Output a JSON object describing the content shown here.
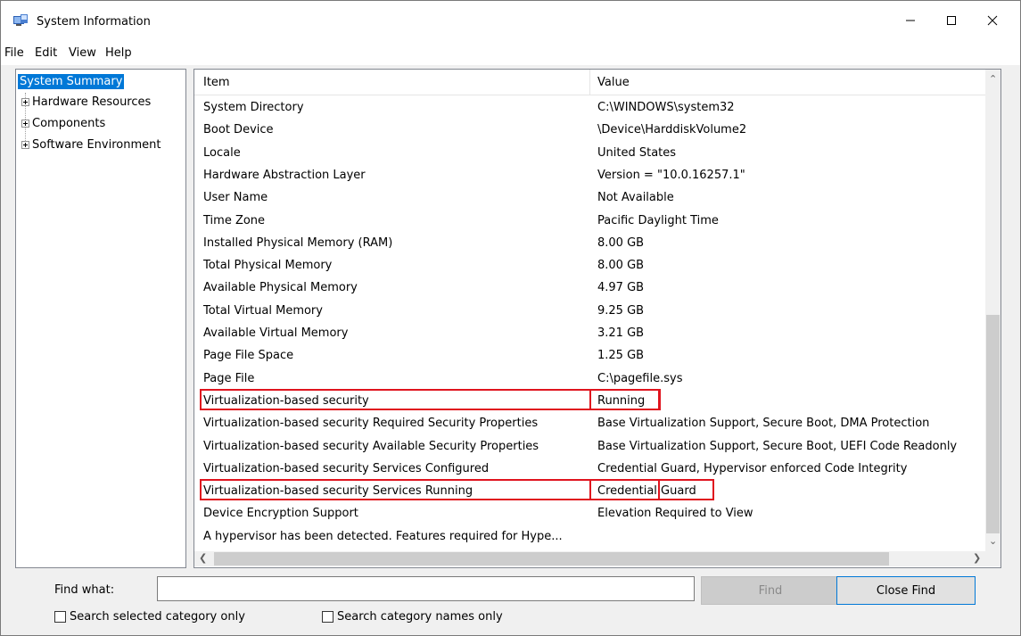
{
  "window": {
    "title": "System Information",
    "icon": "system-information-icon"
  },
  "menu": [
    "File",
    "Edit",
    "View",
    "Help"
  ],
  "tree": {
    "items": [
      {
        "label": "System Summary",
        "selected": true,
        "expandable": false
      },
      {
        "label": "Hardware Resources",
        "selected": false,
        "expandable": true
      },
      {
        "label": "Components",
        "selected": false,
        "expandable": true
      },
      {
        "label": "Software Environment",
        "selected": false,
        "expandable": true
      }
    ]
  },
  "list": {
    "columns": [
      "Item",
      "Value"
    ],
    "rows": [
      {
        "item": "System Directory",
        "value": "C:\\WINDOWS\\system32"
      },
      {
        "item": "Boot Device",
        "value": "\\Device\\HarddiskVolume2"
      },
      {
        "item": "Locale",
        "value": "United States"
      },
      {
        "item": "Hardware Abstraction Layer",
        "value": "Version = \"10.0.16257.1\""
      },
      {
        "item": "User Name",
        "value": "Not Available"
      },
      {
        "item": "Time Zone",
        "value": "Pacific Daylight Time"
      },
      {
        "item": "Installed Physical Memory (RAM)",
        "value": "8.00 GB"
      },
      {
        "item": "Total Physical Memory",
        "value": "8.00 GB"
      },
      {
        "item": "Available Physical Memory",
        "value": "4.97 GB"
      },
      {
        "item": "Total Virtual Memory",
        "value": "9.25 GB"
      },
      {
        "item": "Available Virtual Memory",
        "value": "3.21 GB"
      },
      {
        "item": "Page File Space",
        "value": "1.25 GB"
      },
      {
        "item": "Page File",
        "value": "C:\\pagefile.sys"
      },
      {
        "item": "Virtualization-based security",
        "value": "Running"
      },
      {
        "item": "Virtualization-based security Required Security Properties",
        "value": "Base Virtualization Support, Secure Boot, DMA Protection"
      },
      {
        "item": "Virtualization-based security Available Security Properties",
        "value": "Base Virtualization Support, Secure Boot, UEFI Code Readonly"
      },
      {
        "item": "Virtualization-based security Services Configured",
        "value": "Credential Guard, Hypervisor enforced Code Integrity"
      },
      {
        "item": "Virtualization-based security Services Running",
        "value": "Credential Guard"
      },
      {
        "item": "Device Encryption Support",
        "value": "Elevation Required to View"
      },
      {
        "item": "A hypervisor has been detected. Features required for Hype...",
        "value": ""
      }
    ],
    "highlighted_rows": [
      13,
      17
    ],
    "highlight_color": "#e0141e"
  },
  "find": {
    "label": "Find what:",
    "value": "",
    "find_button": "Find",
    "close_button": "Close Find",
    "checkbox_selected_category": "Search selected category only",
    "checkbox_category_names": "Search category names only"
  },
  "colors": {
    "selection": "#0078d7",
    "accent": "#0078d7"
  }
}
